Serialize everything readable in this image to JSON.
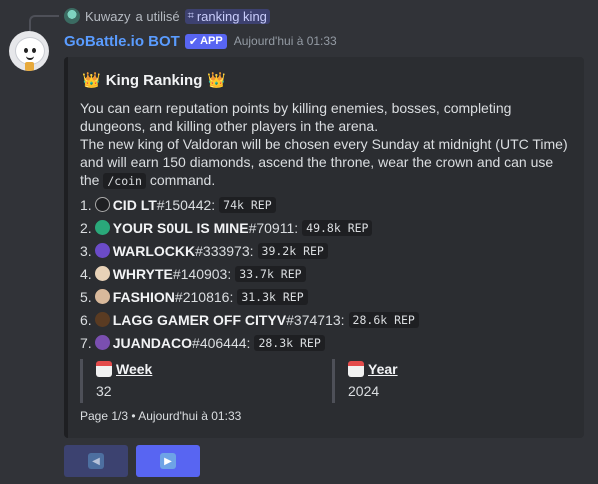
{
  "reply": {
    "user": "Kuwazy",
    "action": "a utilisé",
    "command": "ranking king"
  },
  "message": {
    "username": "GoBattle.io BOT",
    "app_tag": "APP",
    "timestamp": "Aujourd'hui à 01:33"
  },
  "embed": {
    "title": "King Ranking",
    "description_1": "You can earn reputation points by killing enemies, bosses, completing dungeons, and killing other players in the arena.",
    "description_2_pre": "The new king of Valdoran will be chosen every Sunday at midnight (UTC Time) and will earn 150 diamonds, ascend the throne, wear the crown and can use the",
    "description_2_code": "/coin",
    "description_2_post": "command.",
    "rankings": [
      {
        "rank": "1.",
        "name": "CID LT",
        "tag": "#150442",
        "rep": "74k REP",
        "avatar_color": "#1e1f22"
      },
      {
        "rank": "2.",
        "name": "YOUR S0UL IS MINE",
        "tag": "#70911",
        "rep": "49.8k REP",
        "avatar_color": "#2aa87a"
      },
      {
        "rank": "3.",
        "name": "WARLOCKK",
        "tag": "#333973",
        "rep": "39.2k REP",
        "avatar_color": "#6b4bc8"
      },
      {
        "rank": "4.",
        "name": "WHRYTE",
        "tag": "#140903",
        "rep": "33.7k REP",
        "avatar_color": "#e8d2b8"
      },
      {
        "rank": "5.",
        "name": "FASHION",
        "tag": "#210816",
        "rep": "31.3k REP",
        "avatar_color": "#d9b99b"
      },
      {
        "rank": "6.",
        "name": "LAGG GAMER OFF CITYV",
        "tag": "#374713",
        "rep": "28.6k REP",
        "avatar_color": "#5a3b22"
      },
      {
        "rank": "7.",
        "name": "JUANDACO",
        "tag": "#406444",
        "rep": "28.3k REP",
        "avatar_color": "#7a4fb0"
      }
    ],
    "fields": [
      {
        "name": "Week",
        "value": "32"
      },
      {
        "name": "Year",
        "value": "2024"
      }
    ],
    "footer": "Page 1/3 • Aujourd'hui à 01:33"
  },
  "buttons": {
    "prev_label": "◀",
    "next_label": "▶"
  },
  "colors": {
    "background": "#313338",
    "embed_bg": "#2b2d31",
    "username": "#5a9cff",
    "app_tag": "#5865f2",
    "button_next": "#5865f2",
    "button_prev": "#3c4270"
  }
}
